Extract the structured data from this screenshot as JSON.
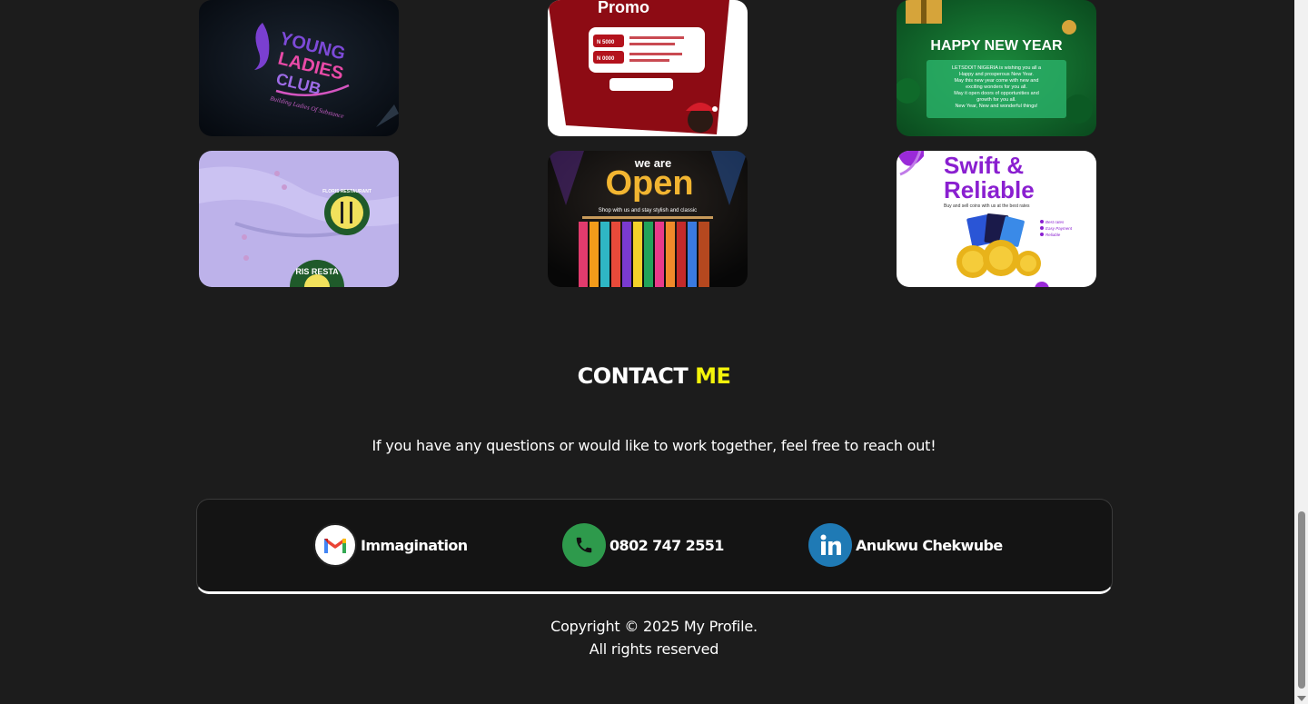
{
  "portfolio": {
    "tiles": [
      {
        "name": "young-ladies-club",
        "lines": [
          "YOUNG",
          "LADIES",
          "CLUB",
          "Building Ladies Of Substance"
        ]
      },
      {
        "name": "promo",
        "lines": [
          "Promo",
          "N 5000",
          "N 0000"
        ]
      },
      {
        "name": "happy-new-year",
        "lines": [
          "HAPPY NEW YEAR",
          "LETSDOIT NIGERIA is wishing you all a",
          "Happy and prosperous New Year.",
          "May this new year come with new and",
          "exciting wonders for you all.",
          "May it open doors of opportunities and",
          "growth for you all.",
          "New Year, New and wonderful things!"
        ]
      },
      {
        "name": "restaurant-shirts",
        "lines": [
          "RIS RESTA",
          "FLORIS RESTAURANT"
        ]
      },
      {
        "name": "we-are-open",
        "lines": [
          "we are",
          "Open",
          "Shop with us and stay stylish and classic"
        ]
      },
      {
        "name": "swift-reliable",
        "lines": [
          "Swift &",
          "Reliable",
          "Buy and sell coins with us at the best rates",
          "Best rates",
          "Easy Payment",
          "Reliable"
        ]
      }
    ]
  },
  "contact": {
    "title_main": "CONTACT",
    "title_accent": "ME",
    "description": "If you have any questions or would like to work together, feel free to reach out!",
    "items": [
      {
        "label": "Immagination",
        "icon": "gmail-icon"
      },
      {
        "label": "0802 747 2551",
        "icon": "phone-icon"
      },
      {
        "label": "Anukwu Chekwube",
        "icon": "linkedin-icon"
      }
    ]
  },
  "footer": {
    "copyright": "Copyright © 2025 My Profile.",
    "rights": "All rights reserved"
  },
  "colors": {
    "background": "#1c1c1c",
    "accent": "#f4f40b",
    "phone_green": "#2e9a4c",
    "linkedin_blue": "#1f7ab5"
  }
}
